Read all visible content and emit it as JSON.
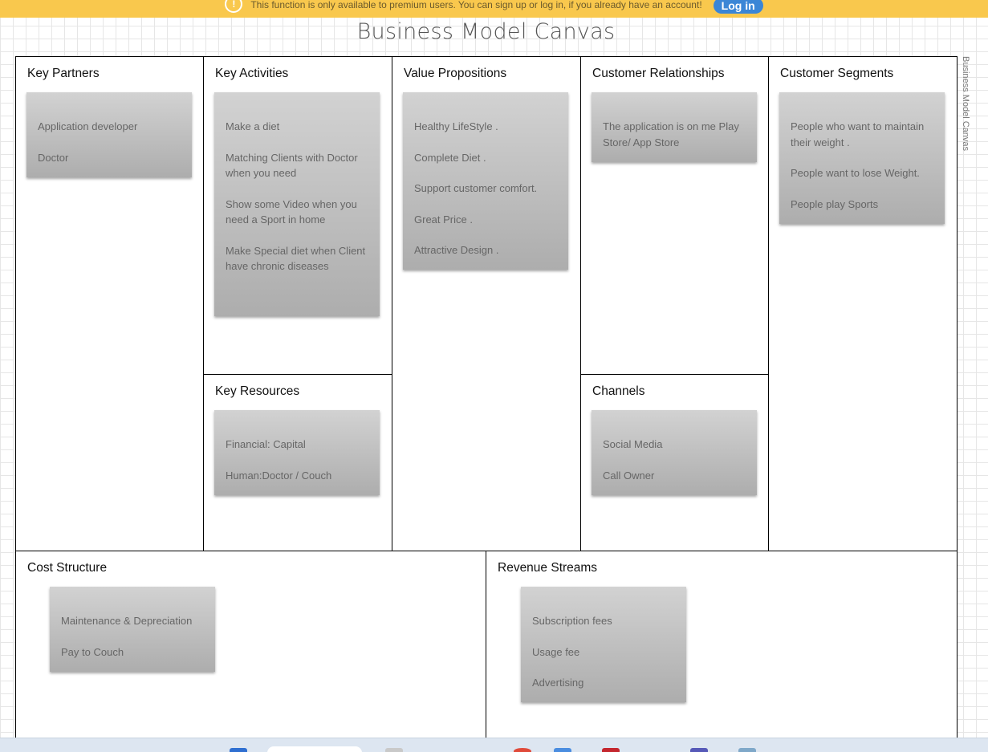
{
  "banner": {
    "message": "This function is only available to premium users. You can sign up or log in, if you already have an account!",
    "login_label": "Log in",
    "warn_icon": "!"
  },
  "title": "Business Model Canvas",
  "side_label": "Business Model Canvas",
  "sections": {
    "key_partners": {
      "title": "Key Partners",
      "items": [
        "Application developer",
        "Doctor"
      ]
    },
    "key_activities": {
      "title": "Key Activities",
      "items": [
        "Make a diet",
        "Matching Clients with Doctor when you need",
        "Show some Video when you need a Sport in home",
        "Make Special diet when Client have chronic diseases"
      ]
    },
    "key_resources": {
      "title": "Key Resources",
      "items": [
        "Financial: Capital",
        "Human:Doctor / Couch"
      ]
    },
    "value_propositions": {
      "title": "Value Propositions",
      "items": [
        "Healthy LifeStyle .",
        "Complete Diet .",
        "Support customer comfort.",
        "Great Price .",
        "Attractive Design ."
      ]
    },
    "customer_relationships": {
      "title": "Customer Relationships",
      "items": [
        "The application is on me Play Store/ App Store"
      ]
    },
    "channels": {
      "title": "Channels",
      "items": [
        "Social Media",
        "Call Owner"
      ]
    },
    "customer_segments": {
      "title": "Customer Segments",
      "items": [
        "People who want to maintain their weight .",
        "People want to lose Weight.",
        "People play Sports"
      ]
    },
    "cost_structure": {
      "title": "Cost Structure",
      "items": [
        "Maintenance & Depreciation",
        "Pay to Couch"
      ]
    },
    "revenue_streams": {
      "title": "Revenue Streams",
      "items": [
        "Subscription fees",
        "Usage fee",
        "Advertising"
      ]
    }
  },
  "colors": {
    "banner": "#f9c84d",
    "login_button": "#3b86d6",
    "note": "#bdbdbd"
  }
}
